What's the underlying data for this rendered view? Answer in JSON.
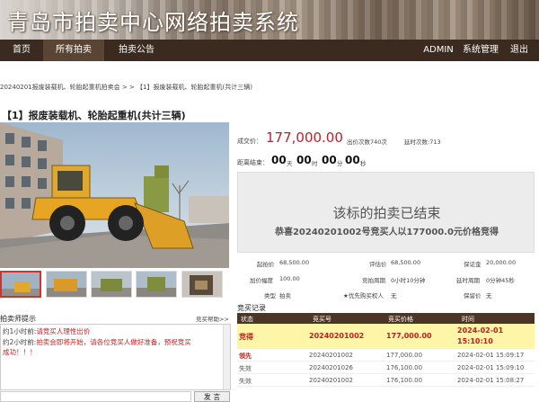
{
  "header": {
    "title": "青岛市拍卖中心网络拍卖系统"
  },
  "nav": {
    "home": "首页",
    "all_auctions": "所有拍卖",
    "announcements": "拍卖公告",
    "admin": "ADMIN",
    "system_manage": "系统管理",
    "logout": "退出"
  },
  "breadcrumb": "20240201报废装载机、轮胎起重机拍卖会 > > 【1】报废装载机、轮胎起重机(共计三辆)",
  "item": {
    "title": "【1】报废装载机、轮胎起重机(共计三辆)",
    "deal_price_label": "成交价：",
    "deal_price": "177,000.00",
    "bid_count": "出价次数740次",
    "delay_count": "延时次数:713",
    "countdown_label": "距离结束：",
    "cd_day": "00",
    "cd_day_unit": "天",
    "cd_hour": "00",
    "cd_hour_unit": "时",
    "cd_min": "00",
    "cd_min_unit": "分",
    "cd_sec": "00",
    "cd_sec_unit": "秒",
    "ended_title": "该标的拍卖已结束",
    "ended_msg": "恭喜20240201002号竞买人以177000.0元价格竞得"
  },
  "details": {
    "start_price_label": "起拍价",
    "start_price": "68,500.00",
    "eval_price_label": "评估价",
    "eval_price": "68,500.00",
    "deposit_label": "保证金",
    "deposit": "20,000.00",
    "increment_label": "加价幅度",
    "increment": "100.00",
    "bid_period_label": "竞拍周期",
    "bid_period": "0小时10分钟",
    "delay_period_label": "延时周期",
    "delay_period": "0分钟45秒",
    "type_label": "类型",
    "type": "拍卖",
    "priority_label": "★优先购买权人",
    "priority": "无",
    "reserve_label": "保留价",
    "reserve": "无"
  },
  "records": {
    "title": "竞买记录",
    "headers": [
      "状态",
      "竞买号",
      "竞买价格",
      "时间"
    ],
    "rows": [
      {
        "status": "竞得",
        "bidder": "20240201002",
        "price": "177,000.00",
        "date": "2024-02-01",
        "time": "15:10:10"
      },
      {
        "status": "领先",
        "bidder": "20240201002",
        "price": "177,000.00",
        "date": "2024-02-01 15:09:17"
      },
      {
        "status": "失效",
        "bidder": "20240201026",
        "price": "176,100.00",
        "date": "2024-02-01 15:09:10"
      },
      {
        "status": "失效",
        "bidder": "20240201002",
        "price": "176,100.00",
        "date": "2024-02-01 15:08:27"
      }
    ]
  },
  "tips": {
    "title": "拍卖师提示",
    "help": "竞买帮助>>",
    "lines": [
      {
        "time": "约1小时前:",
        "msg": "请竞买人理性出价"
      },
      {
        "time": "约2小时前:",
        "msg": "拍卖会即将开始，请各位竞买人做好准备，预祝竞买"
      },
      {
        "time": "",
        "msg": "成功！！！"
      }
    ]
  },
  "send_label": "发 言",
  "colors": {
    "accent": "#b3262b",
    "nav_bg": "#3a2a1f",
    "win_row_bg": "#fdf5a7"
  }
}
